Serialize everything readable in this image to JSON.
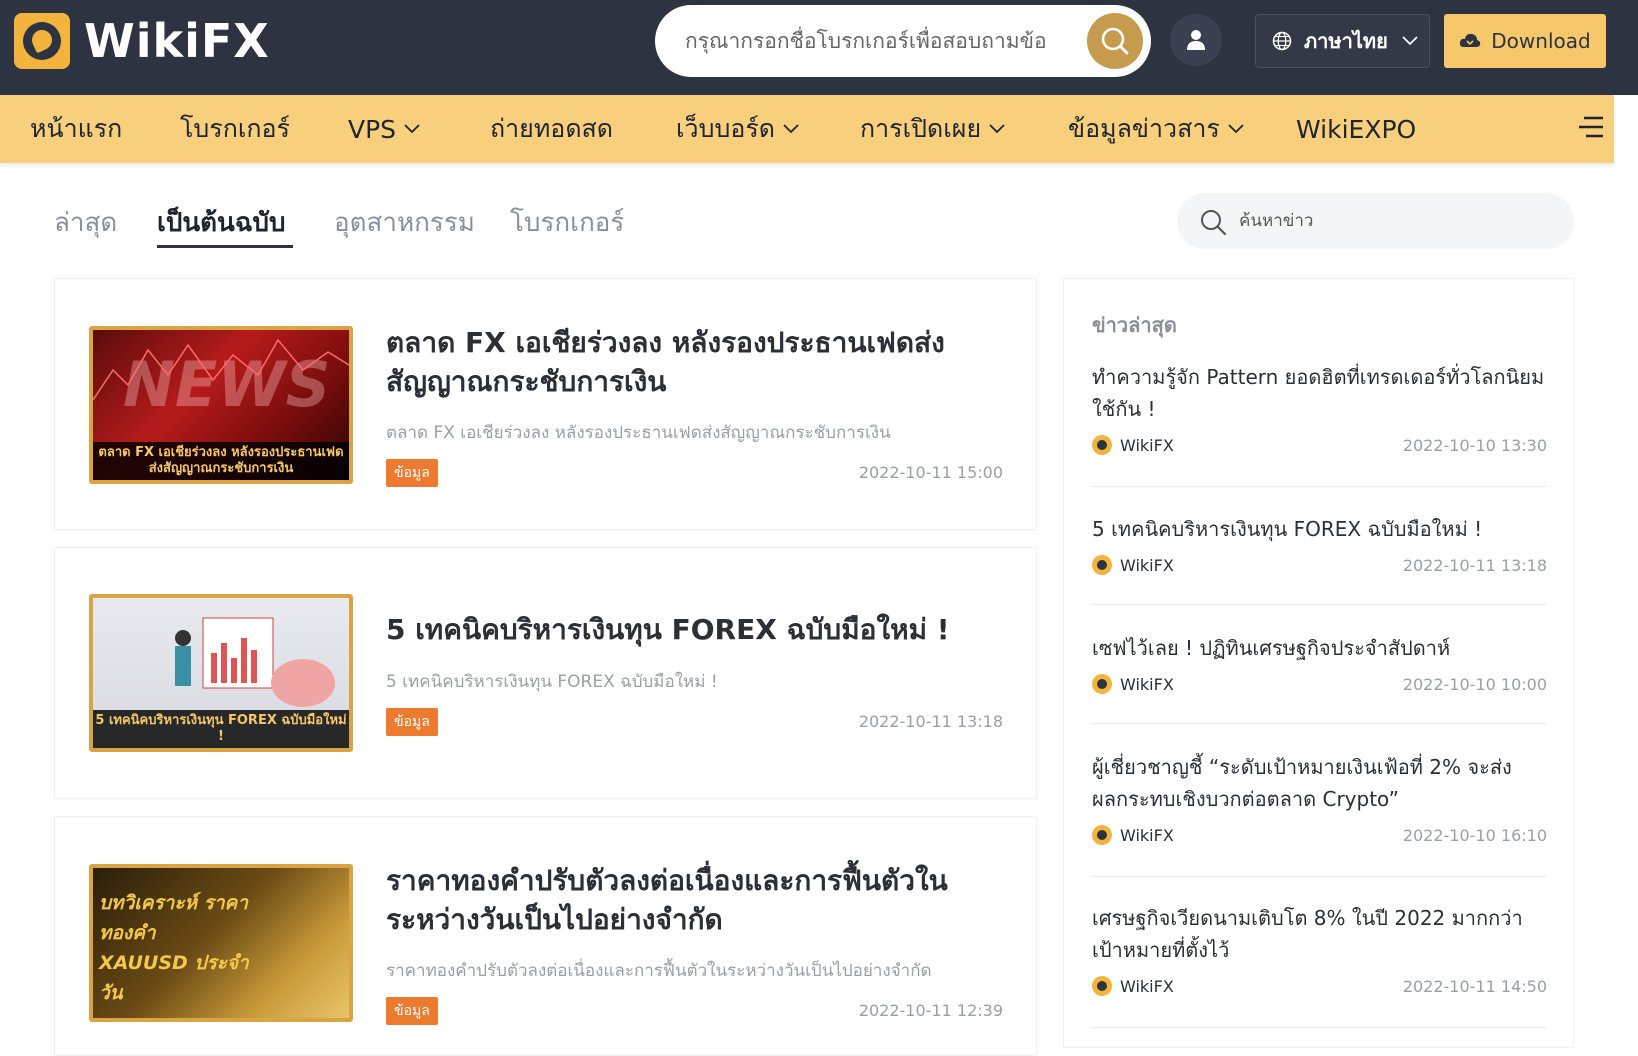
{
  "header": {
    "logo_text": "WikiFX",
    "search_placeholder": "กรุณากรอกชื่อโบรกเกอร์เพื่อสอบถามข้อมูล",
    "language_label": "ภาษาไทย",
    "download_label": "Download"
  },
  "nav": {
    "items": [
      {
        "label": "หน้าแรก"
      },
      {
        "label": "โบรกเกอร์"
      },
      {
        "label": "VPS"
      },
      {
        "label": "ถ่ายทอดสด"
      },
      {
        "label": "เว็บบอร์ด"
      },
      {
        "label": "การเปิดเผย"
      },
      {
        "label": "ข้อมูลข่าวสาร"
      },
      {
        "label": "WikiEXPO"
      }
    ]
  },
  "tabs": {
    "items": [
      {
        "label": "ล่าสุด"
      },
      {
        "label": "เป็นต้นฉบับ"
      },
      {
        "label": "อุตสาหกรรม"
      },
      {
        "label": "โบรกเกอร์"
      }
    ],
    "active_index": 1,
    "news_search_placeholder": "ค้นหาข่าว"
  },
  "articles": [
    {
      "title": "ตลาด FX เอเชียร่วงลง หลังรองประธานเฟดส่งสัญญาณกระชับการเงิน",
      "summary": "ตลาด FX เอเชียร่วงลง หลังรองประธานเฟดส่งสัญญาณกระชับการเงิน",
      "tag": "ข้อมูล",
      "date": "2022-10-11 15:00",
      "thumb_caption": "ตลาด FX เอเชียร่วงลง หลังรองประธานเฟดส่งสัญญาณกระชับการเงิน",
      "thumb_word": "NEWS"
    },
    {
      "title": "5 เทคนิคบริหารเงินทุน FOREX ฉบับมือใหม่ !",
      "summary": "5 เทคนิคบริหารเงินทุน FOREX ฉบับมือใหม่ !",
      "tag": "ข้อมูล",
      "date": "2022-10-11 13:18",
      "thumb_caption": "5 เทคนิคบริหารเงินทุน FOREX ฉบับมือใหม่ !",
      "thumb_word": ""
    },
    {
      "title": "ราคาทองคำปรับตัวลงต่อเนื่องและการฟื้นตัวในระหว่างวันเป็นไปอย่างจำกัด",
      "summary": "ราคาทองคำปรับตัวลงต่อเนื่องและการฟื้นตัวในระหว่างวันเป็นไปอย่างจำกัด",
      "tag": "ข้อมูล",
      "date": "2022-10-11 12:39",
      "thumb_caption": "",
      "thumb_word": "บทวิเคราะห์ ราคาทองคำ XAUUSD ประจำวัน"
    }
  ],
  "sidebar": {
    "heading": "ข่าวล่าสุด",
    "items": [
      {
        "title": "ทำความรู้จัก Pattern ยอดฮิตที่เทรดเดอร์ทั่วโลกนิยมใช้กัน !",
        "source": "WikiFX",
        "date": "2022-10-10 13:30"
      },
      {
        "title": "5 เทคนิคบริหารเงินทุน FOREX ฉบับมือใหม่ !",
        "source": "WikiFX",
        "date": "2022-10-11 13:18"
      },
      {
        "title": "เซฟไว้เลย ! ปฏิทินเศรษฐกิจประจำสัปดาห์",
        "source": "WikiFX",
        "date": "2022-10-10 10:00"
      },
      {
        "title": "ผู้เชี่ยวชาญชี้ “ระดับเป้าหมายเงินเฟ้อที่ 2% จะส่งผลกระทบเชิงบวกต่อตลาด Crypto”",
        "source": "WikiFX",
        "date": "2022-10-10 16:10"
      },
      {
        "title": "เศรษฐกิจเวียดนามเติบโต 8% ในปี 2022 มากกว่าเป้าหมายที่ตั้งไว้",
        "source": "WikiFX",
        "date": "2022-10-11 14:50"
      }
    ]
  },
  "colors": {
    "header_bg": "#2d3341",
    "nav_bg": "#f7cf7d",
    "accent_gold": "#c69b4e",
    "tag_orange": "#ec7a2f"
  }
}
